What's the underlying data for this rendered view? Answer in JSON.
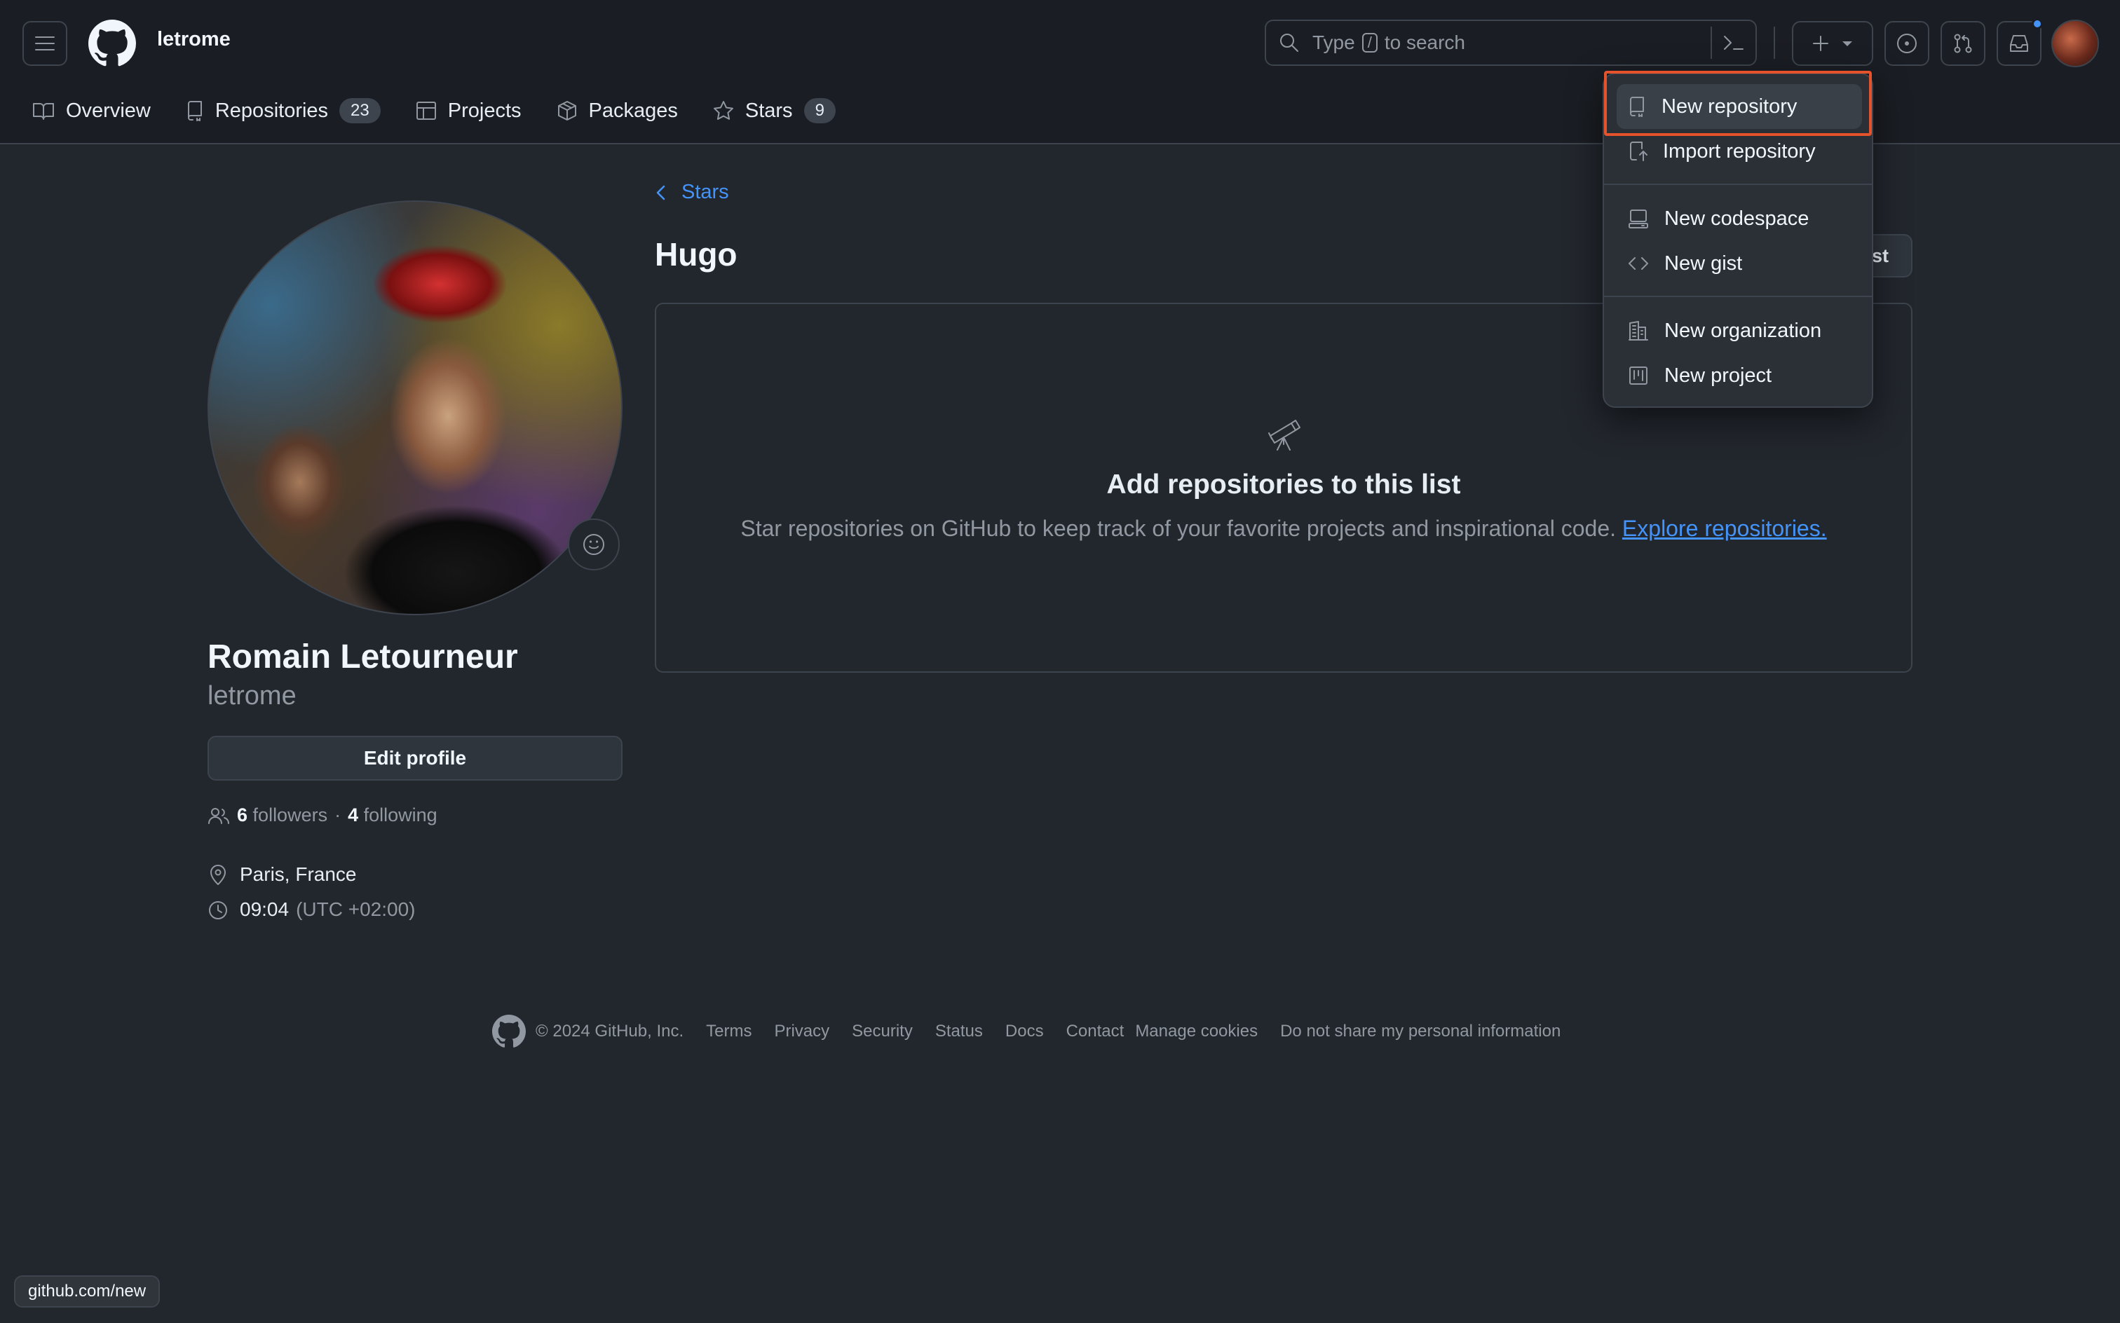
{
  "header": {
    "username": "letrome",
    "search": {
      "prefix": "Type",
      "key": "/",
      "suffix": "to search"
    }
  },
  "tabs": [
    {
      "label": "Overview",
      "icon": "book-icon"
    },
    {
      "label": "Repositories",
      "icon": "repo-icon",
      "count": "23"
    },
    {
      "label": "Projects",
      "icon": "table-icon"
    },
    {
      "label": "Packages",
      "icon": "package-icon"
    },
    {
      "label": "Stars",
      "icon": "star-icon",
      "count": "9"
    }
  ],
  "profile": {
    "name": "Romain Letourneur",
    "handle": "letrome",
    "edit_label": "Edit profile",
    "followers_count": "6",
    "followers_label": "followers",
    "separator": "·",
    "following_count": "4",
    "following_label": "following",
    "location": "Paris, France",
    "time": "09:04",
    "timezone": "(UTC +02:00)"
  },
  "main": {
    "breadcrumb": "Stars",
    "list_title": "Hugo",
    "edit_list_label": "st",
    "blank_title": "Add repositories to this list",
    "blank_text": "Star repositories on GitHub to keep track of your favorite projects and inspirational code.",
    "blank_link": "Explore repositories."
  },
  "dropdown": {
    "items": [
      {
        "label": "New repository",
        "icon": "repo-icon"
      },
      {
        "label": "Import repository",
        "icon": "repo-push-icon"
      },
      {
        "label": "New codespace",
        "icon": "codespaces-icon"
      },
      {
        "label": "New gist",
        "icon": "code-icon"
      },
      {
        "label": "New organization",
        "icon": "organization-icon"
      },
      {
        "label": "New project",
        "icon": "project-icon"
      }
    ]
  },
  "footer": {
    "copyright": "© 2024 GitHub, Inc.",
    "links": [
      "Terms",
      "Privacy",
      "Security",
      "Status",
      "Docs",
      "Contact",
      "Manage cookies",
      "Do not share my personal information"
    ]
  },
  "statusbar": {
    "url": "github.com/new"
  },
  "colors": {
    "accent": "#4493f8",
    "highlight": "#e5532d",
    "background": "#22262d",
    "header": "#1a1d23"
  }
}
